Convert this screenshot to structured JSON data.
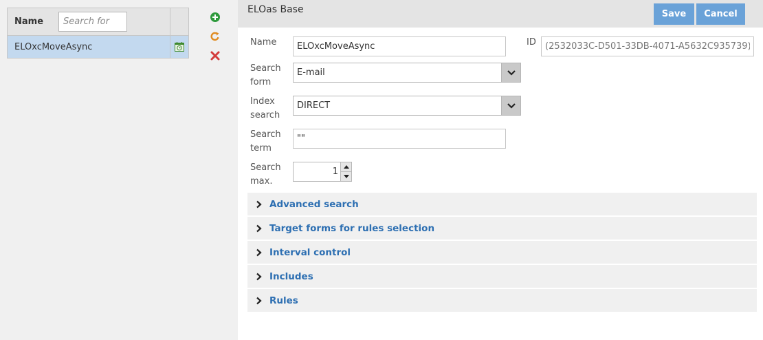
{
  "list": {
    "header_label": "Name",
    "search_placeholder": "Search for",
    "rows": [
      {
        "name": "ELOxcMoveAsync",
        "icon": "scheduled-task-icon"
      }
    ]
  },
  "side_actions": [
    "add-icon",
    "refresh-icon",
    "delete-icon"
  ],
  "form": {
    "title": "ELOas Base",
    "save_label": "Save",
    "cancel_label": "Cancel",
    "name_label": "Name",
    "name_value": "ELOxcMoveAsync",
    "id_label": "ID",
    "id_value": "(2532033C-D501-33DB-4071-A5632C935739)",
    "search_form_label_1": "Search",
    "search_form_label_2": "form",
    "search_form_value": "E-mail",
    "index_search_label_1": "Index",
    "index_search_label_2": "search",
    "index_search_value": "DIRECT",
    "search_term_label_1": "Search",
    "search_term_label_2": "term",
    "search_term_value": "\"\"",
    "search_max_label_1": "Search",
    "search_max_label_2": "max.",
    "search_max_value": "1"
  },
  "sections": [
    {
      "label": "Advanced search"
    },
    {
      "label": "Target forms for rules selection"
    },
    {
      "label": "Interval control"
    },
    {
      "label": "Includes"
    },
    {
      "label": "Rules"
    }
  ],
  "colors": {
    "accent": "#6aa2d8",
    "link": "#2d6fb2",
    "selected_row": "#c3d9ef",
    "add": "#2e9a3c",
    "refresh": "#e08a1e",
    "delete": "#d33b3b"
  }
}
